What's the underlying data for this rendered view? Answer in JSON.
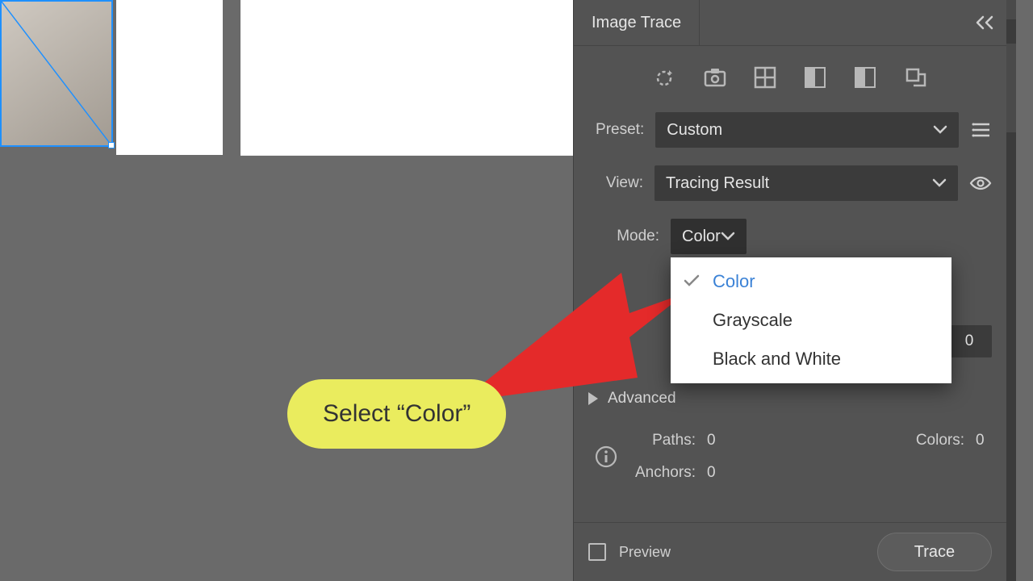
{
  "panel": {
    "title": "Image Trace",
    "preset_label": "Preset:",
    "preset_value": "Custom",
    "view_label": "View:",
    "view_value": "Tracing Result",
    "mode_label": "Mode:",
    "mode_value": "Color",
    "mode_options": [
      "Color",
      "Grayscale",
      "Black and White"
    ],
    "mode_selected_index": 0,
    "hidden_field_value": "0",
    "advanced_label": "Advanced",
    "stats": {
      "paths_label": "Paths:",
      "paths_value": "0",
      "colors_label": "Colors:",
      "colors_value": "0",
      "anchors_label": "Anchors:",
      "anchors_value": "0"
    },
    "preview_label": "Preview",
    "trace_button": "Trace"
  },
  "tutorial": {
    "callout_text": "Select “Color”"
  }
}
